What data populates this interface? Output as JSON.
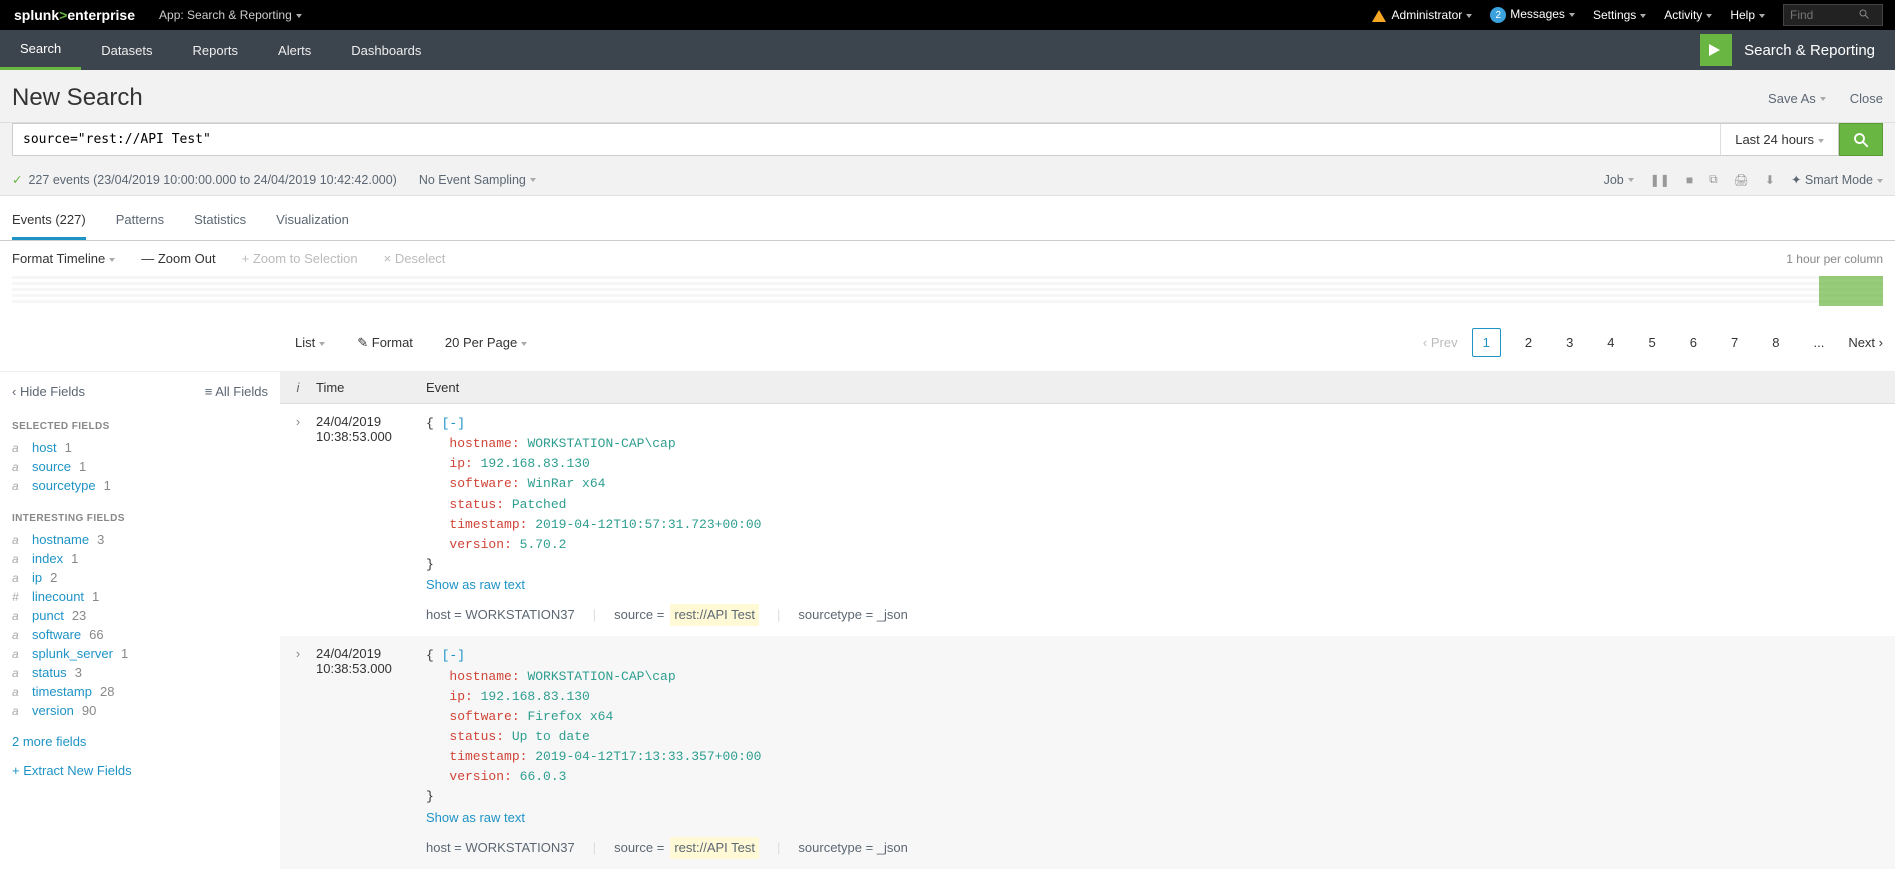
{
  "header": {
    "logo_splunk": "splunk",
    "logo_gt": ">",
    "logo_enterprise": "enterprise",
    "app_label": "App: Search & Reporting",
    "admin": "Administrator",
    "messages": "Messages",
    "messages_count": "2",
    "settings": "Settings",
    "activity": "Activity",
    "help": "Help",
    "find_placeholder": "Find"
  },
  "nav": {
    "items": [
      {
        "label": "Search"
      },
      {
        "label": "Datasets"
      },
      {
        "label": "Reports"
      },
      {
        "label": "Alerts"
      },
      {
        "label": "Dashboards"
      }
    ],
    "brand": "Search & Reporting"
  },
  "page": {
    "title": "New Search",
    "save_as": "Save As",
    "close": "Close"
  },
  "search": {
    "query": "source=\"rest://API Test\"",
    "time_range": "Last 24 hours"
  },
  "status": {
    "summary": "227 events (23/04/2019 10:00:00.000 to 24/04/2019 10:42:42.000)",
    "sampling": "No Event Sampling",
    "job": "Job",
    "smart_mode": "Smart Mode"
  },
  "tabs": {
    "events": "Events (227)",
    "patterns": "Patterns",
    "statistics": "Statistics",
    "visualization": "Visualization"
  },
  "timeline": {
    "format": "Format Timeline",
    "zoom_out": "Zoom Out",
    "zoom_sel": "Zoom to Selection",
    "deselect": "Deselect",
    "per_col": "1 hour per column"
  },
  "view": {
    "list": "List",
    "format": "Format",
    "per_page": "20 Per Page"
  },
  "pagination": {
    "prev": "Prev",
    "pages": [
      "1",
      "2",
      "3",
      "4",
      "5",
      "6",
      "7",
      "8"
    ],
    "ellipsis": "...",
    "next": "Next"
  },
  "fields": {
    "hide": "Hide Fields",
    "all": "All Fields",
    "selected_title": "SELECTED FIELDS",
    "interesting_title": "INTERESTING FIELDS",
    "selected": [
      {
        "t": "a",
        "name": "host",
        "count": "1"
      },
      {
        "t": "a",
        "name": "source",
        "count": "1"
      },
      {
        "t": "a",
        "name": "sourcetype",
        "count": "1"
      }
    ],
    "interesting": [
      {
        "t": "a",
        "name": "hostname",
        "count": "3"
      },
      {
        "t": "a",
        "name": "index",
        "count": "1"
      },
      {
        "t": "a",
        "name": "ip",
        "count": "2"
      },
      {
        "t": "#",
        "name": "linecount",
        "count": "1"
      },
      {
        "t": "a",
        "name": "punct",
        "count": "23"
      },
      {
        "t": "a",
        "name": "software",
        "count": "66"
      },
      {
        "t": "a",
        "name": "splunk_server",
        "count": "1"
      },
      {
        "t": "a",
        "name": "status",
        "count": "3"
      },
      {
        "t": "a",
        "name": "timestamp",
        "count": "28"
      },
      {
        "t": "a",
        "name": "version",
        "count": "90"
      }
    ],
    "more": "2 more fields",
    "extract": "+ Extract New Fields"
  },
  "ev_header": {
    "i": "i",
    "time": "Time",
    "event": "Event"
  },
  "events": [
    {
      "date": "24/04/2019",
      "time": "10:38:53.000",
      "kv": [
        {
          "k": "hostname",
          "v": "WORKSTATION-CAP\\cap"
        },
        {
          "k": "ip",
          "v": "192.168.83.130"
        },
        {
          "k": "software",
          "v": "WinRar x64"
        },
        {
          "k": "status",
          "v": "Patched"
        },
        {
          "k": "timestamp",
          "v": "2019-04-12T10:57:31.723+00:00"
        },
        {
          "k": "version",
          "v": "5.70.2"
        }
      ],
      "raw": "Show as raw text",
      "meta": {
        "host_k": "host =",
        "host_v": "WORKSTATION37",
        "source_k": "source =",
        "source_v": "rest://API Test",
        "st_k": "sourcetype =",
        "st_v": "_json"
      }
    },
    {
      "date": "24/04/2019",
      "time": "10:38:53.000",
      "kv": [
        {
          "k": "hostname",
          "v": "WORKSTATION-CAP\\cap"
        },
        {
          "k": "ip",
          "v": "192.168.83.130"
        },
        {
          "k": "software",
          "v": "Firefox x64"
        },
        {
          "k": "status",
          "v": "Up to date"
        },
        {
          "k": "timestamp",
          "v": "2019-04-12T17:13:33.357+00:00"
        },
        {
          "k": "version",
          "v": "66.0.3"
        }
      ],
      "raw": "Show as raw text",
      "meta": {
        "host_k": "host =",
        "host_v": "WORKSTATION37",
        "source_k": "source =",
        "source_v": "rest://API Test",
        "st_k": "sourcetype =",
        "st_v": "_json"
      }
    }
  ],
  "json_tokens": {
    "open": "{",
    "close": "}",
    "collapse": "[-]"
  }
}
